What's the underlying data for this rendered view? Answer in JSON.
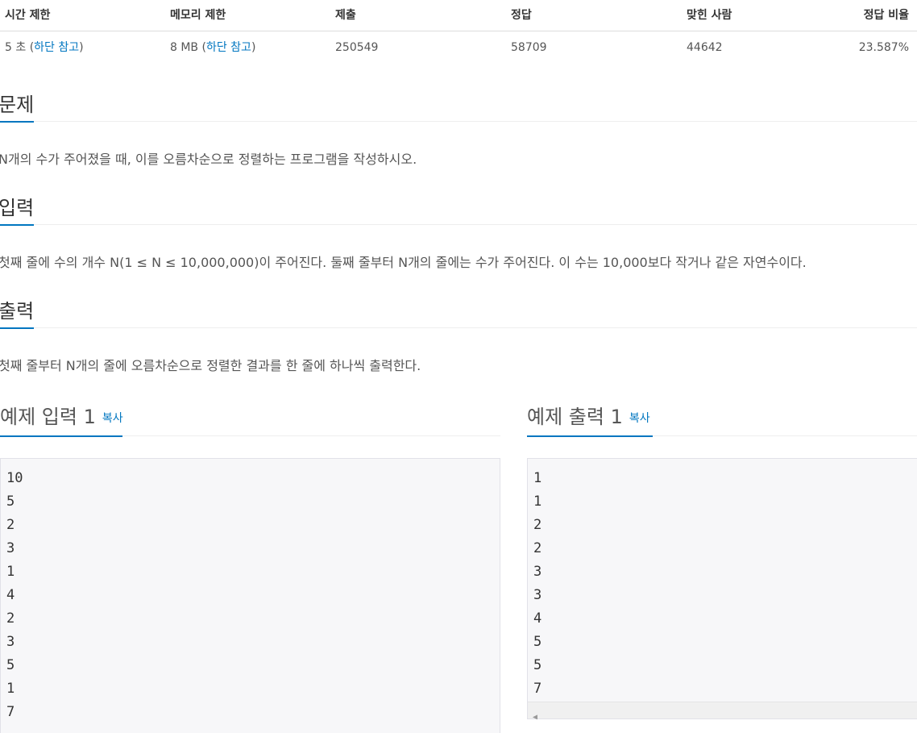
{
  "stats": {
    "headers": [
      "시간 제한",
      "메모리 제한",
      "제출",
      "정답",
      "맞힌 사람",
      "정답 비율"
    ],
    "time_limit": "5 초",
    "memory_limit": "8 MB",
    "note_link": "하단 참고",
    "submissions": "250549",
    "accepted": "58709",
    "solvers": "44642",
    "ratio": "23.587%"
  },
  "sections": {
    "problem": {
      "title": "문제",
      "text": "N개의 수가 주어졌을 때, 이를 오름차순으로 정렬하는 프로그램을 작성하시오."
    },
    "input": {
      "title": "입력",
      "text": "첫째 줄에 수의 개수 N(1 ≤ N ≤ 10,000,000)이 주어진다. 둘째 줄부터 N개의 줄에는 수가 주어진다. 이 수는 10,000보다 작거나 같은 자연수이다."
    },
    "output": {
      "title": "출력",
      "text": "첫째 줄부터 N개의 줄에 오름차순으로 정렬한 결과를 한 줄에 하나씩 출력한다."
    }
  },
  "samples": {
    "input": {
      "title": "예제 입력 1",
      "copy_label": "복사",
      "lines": [
        "10",
        "5",
        "2",
        "3",
        "1",
        "4",
        "2",
        "3",
        "5",
        "1",
        "7"
      ]
    },
    "output": {
      "title": "예제 출력 1",
      "copy_label": "복사",
      "lines": [
        "1",
        "1",
        "2",
        "2",
        "3",
        "3",
        "4",
        "5",
        "5",
        "7"
      ]
    }
  },
  "colors": {
    "accent": "#0076c0",
    "pre_background": "#f7f7f9"
  }
}
